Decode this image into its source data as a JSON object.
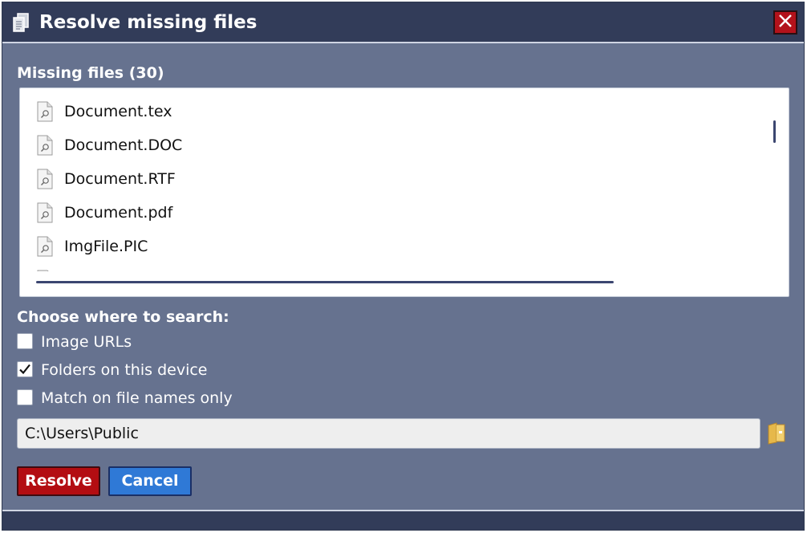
{
  "window": {
    "title": "Resolve missing files",
    "title_icon": "documents-icon",
    "close_icon": "close-icon"
  },
  "missing": {
    "label": "Missing files (30)",
    "files": [
      {
        "name": "Document.tex",
        "icon": "file-search-icon"
      },
      {
        "name": "Document.DOC",
        "icon": "file-search-icon"
      },
      {
        "name": "Document.RTF",
        "icon": "file-search-icon"
      },
      {
        "name": "Document.pdf",
        "icon": "file-search-icon"
      },
      {
        "name": "ImgFile.PIC",
        "icon": "file-search-icon"
      }
    ]
  },
  "search": {
    "label": "Choose where to search:",
    "options": [
      {
        "label": "Image URLs",
        "checked": false
      },
      {
        "label": "Folders on this device",
        "checked": true
      },
      {
        "label": "Match on file names only",
        "checked": false
      }
    ],
    "path_value": "C:\\Users\\Public",
    "folder_icon": "folder-icon"
  },
  "buttons": {
    "resolve_label": "Resolve",
    "cancel_label": "Cancel"
  },
  "colors": {
    "dialog_bg": "#66728f",
    "titlebar_bg": "#323c59",
    "resolve": "#b30d12",
    "cancel": "#2f79d6",
    "close": "#b3121b"
  }
}
